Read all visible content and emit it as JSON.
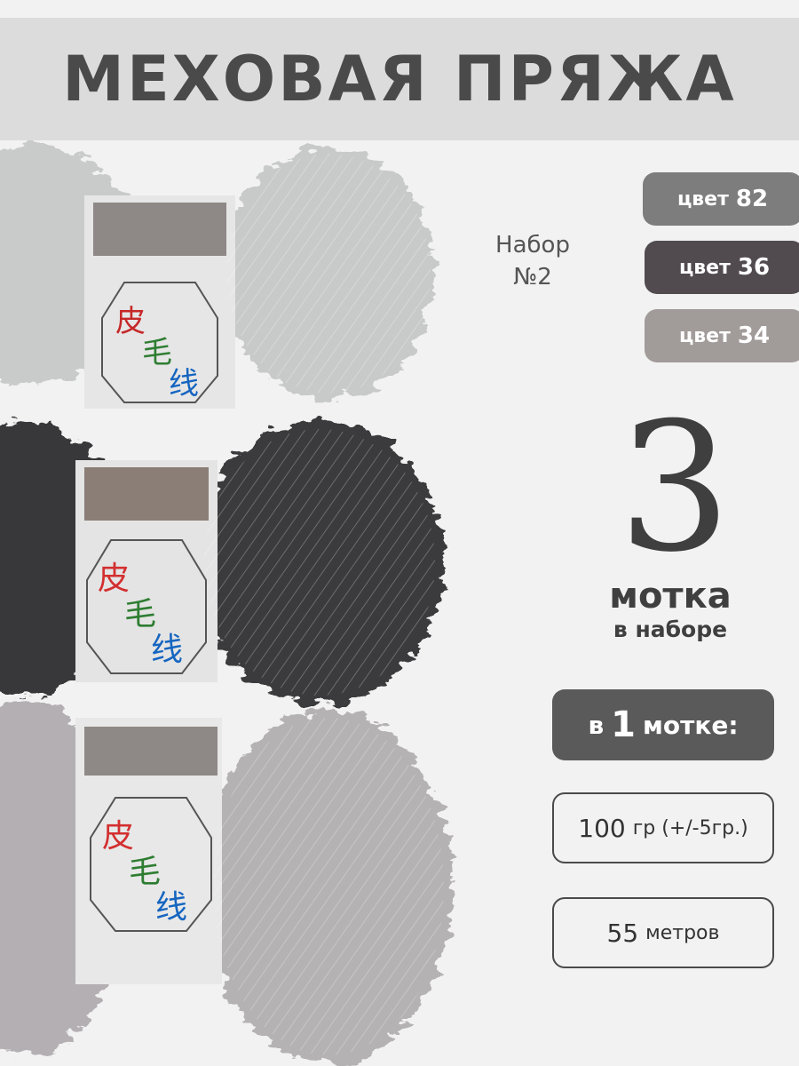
{
  "header": {
    "title": "МЕХОВАЯ ПРЯЖА"
  },
  "set": {
    "line1": "Набор",
    "line2": "№2"
  },
  "colors": [
    {
      "word": "цвет",
      "code": "82",
      "bg": "#7d7d7d"
    },
    {
      "word": "цвет",
      "code": "36",
      "bg": "#514b50"
    },
    {
      "word": "цвет",
      "code": "34",
      "bg": "#a19b99"
    }
  ],
  "count": {
    "number": "3",
    "word": "мотка",
    "sub": "в наборе"
  },
  "per_skein": {
    "prefix": "в",
    "number": "1",
    "suffix": "мотке:"
  },
  "specs": {
    "weight_value": "100",
    "weight_unit": "гр (+/-5гр.)",
    "length_value": "55",
    "length_unit": "метров"
  },
  "photo": {
    "description_icon": "yarn-skeins-photo",
    "label_glyphs": [
      "皮",
      "毛",
      "线"
    ],
    "yarn_colors": [
      "#c8cac9",
      "#3a3a3c",
      "#b5b2b4"
    ]
  }
}
